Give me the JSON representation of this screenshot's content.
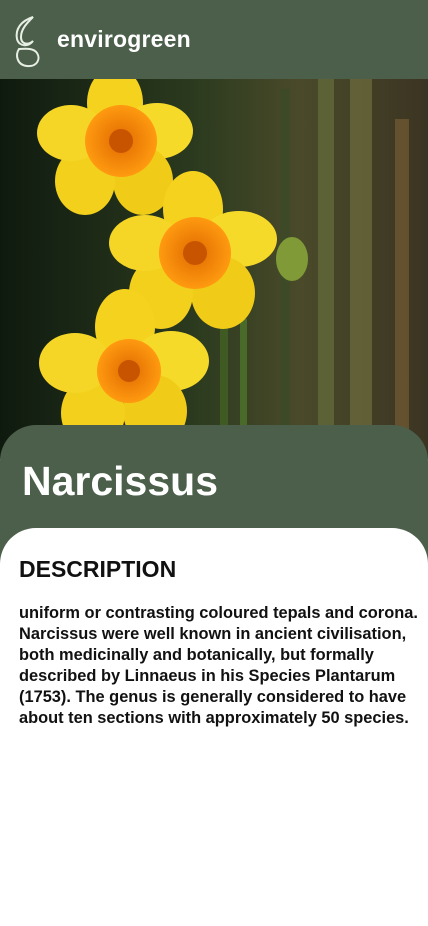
{
  "header": {
    "brand": "envirogreen",
    "logo_icon": "leaf-g-logo-icon",
    "background": "#4b5f4b"
  },
  "hero": {
    "image_alt": "yellow narcissus flowers with orange coronas"
  },
  "plant": {
    "name": "Narcissus"
  },
  "description": {
    "heading": "DESCRIPTION",
    "paragraphs": [
      "uniform or contrasting coloured tepals and corona.",
      "Narcissus were well known in ancient civilisation, both medicinally and botanically, but formally described by Linnaeus in his Species Plantarum (1753). The genus is generally considered to have about ten sections with approximately 50 species."
    ]
  }
}
